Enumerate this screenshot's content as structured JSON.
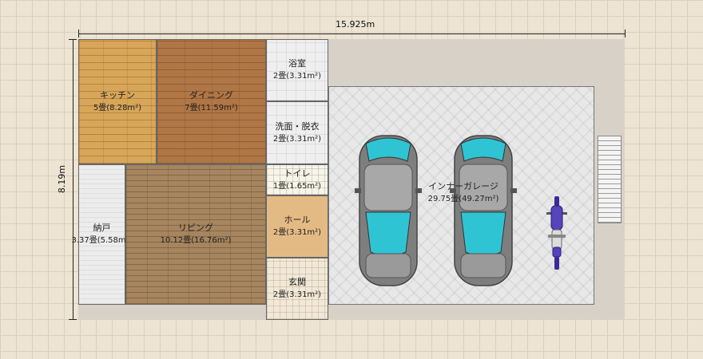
{
  "dimensions": {
    "width_label": "15.925m",
    "height_label": "8.19m"
  },
  "rooms": {
    "kitchen": {
      "name": "キッチン",
      "area": "5畳(8.28m²)"
    },
    "dining": {
      "name": "ダイニング",
      "area": "7畳(11.59m²)"
    },
    "bath": {
      "name": "浴室",
      "area": "2畳(3.31m²)"
    },
    "washroom": {
      "name": "洗面・脱衣",
      "area": "2畳(3.31m²)"
    },
    "toilet": {
      "name": "トイレ",
      "area": "1畳(1.65m²)"
    },
    "hall": {
      "name": "ホール",
      "area": "2畳(3.31m²)"
    },
    "entrance": {
      "name": "玄関",
      "area": "2畳(3.31m²)"
    },
    "storage": {
      "name": "納戸",
      "area": "3.37畳(5.58m²)"
    },
    "living": {
      "name": "リビング",
      "area": "10.12畳(16.76m²)"
    },
    "garage": {
      "name": "インナーガレージ",
      "area": "29.75畳(49.27m²)"
    }
  },
  "icons": {
    "car": "car-topview-icon",
    "motorcycle": "motorcycle-topview-icon",
    "stairs": "stairs-icon"
  },
  "colors": {
    "car_body": "#8a8a8a",
    "car_glass": "#2fc4d4",
    "motorcycle": "#3a2a9a"
  }
}
